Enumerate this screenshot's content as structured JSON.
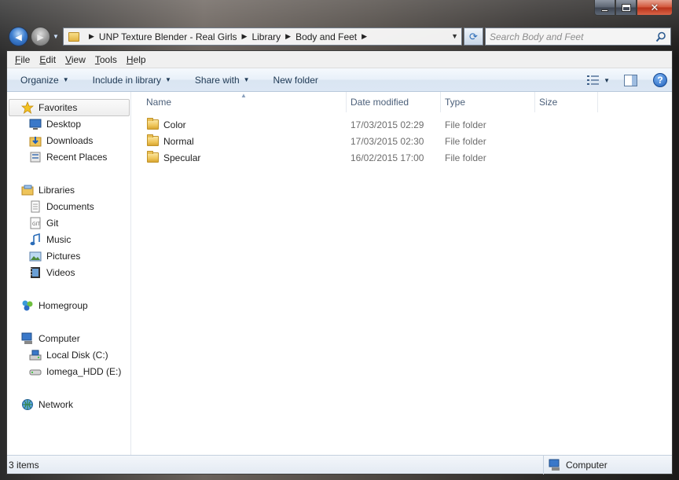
{
  "window": {
    "caption": {
      "close_glyph": "✕"
    },
    "nav": {
      "back_glyph": "◄",
      "forward_glyph": "►"
    },
    "address": {
      "crumbs": [
        "UNP Texture Blender - Real Girls",
        "Library",
        "Body and Feet"
      ]
    },
    "search": {
      "placeholder": "Search Body and Feet"
    }
  },
  "menubar": {
    "items": [
      {
        "key": "F",
        "rest": "ile"
      },
      {
        "key": "E",
        "rest": "dit"
      },
      {
        "key": "V",
        "rest": "iew"
      },
      {
        "key": "T",
        "rest": "ools"
      },
      {
        "key": "H",
        "rest": "elp"
      }
    ]
  },
  "toolbar": {
    "organize": "Organize",
    "include": "Include in library",
    "share": "Share with",
    "new_folder": "New folder",
    "help_glyph": "?"
  },
  "navpane": {
    "favorites": {
      "label": "Favorites",
      "items": [
        "Desktop",
        "Downloads",
        "Recent Places"
      ]
    },
    "libraries": {
      "label": "Libraries",
      "items": [
        "Documents",
        "Git",
        "Music",
        "Pictures",
        "Videos"
      ]
    },
    "homegroup": {
      "label": "Homegroup"
    },
    "computer": {
      "label": "Computer",
      "items": [
        "Local Disk (C:)",
        "Iomega_HDD (E:)"
      ]
    },
    "network": {
      "label": "Network"
    }
  },
  "filelist": {
    "columns": {
      "name": "Name",
      "date": "Date modified",
      "type": "Type",
      "size": "Size"
    },
    "rows": [
      {
        "name": "Color",
        "date": "17/03/2015 02:29",
        "type": "File folder",
        "size": ""
      },
      {
        "name": "Normal",
        "date": "17/03/2015 02:30",
        "type": "File folder",
        "size": ""
      },
      {
        "name": "Specular",
        "date": "16/02/2015 17:00",
        "type": "File folder",
        "size": ""
      }
    ]
  },
  "status": {
    "count": "3 items",
    "location": "Computer"
  }
}
